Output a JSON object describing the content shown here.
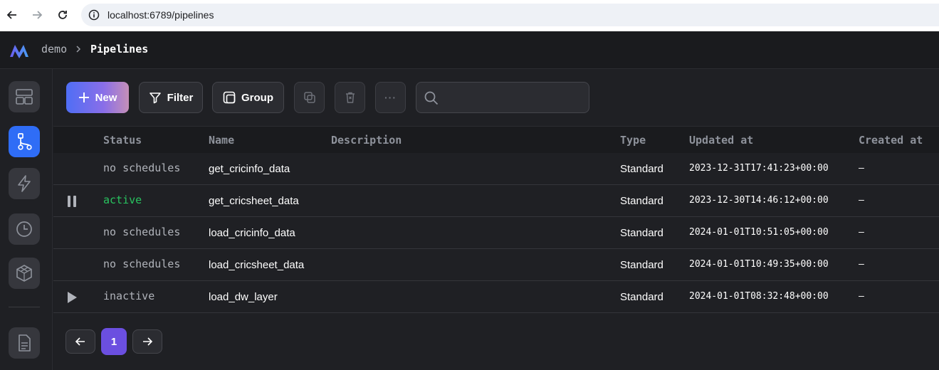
{
  "browser": {
    "url": "localhost:6789/pipelines"
  },
  "header": {
    "breadcrumb_root": "demo",
    "breadcrumb_current": "Pipelines"
  },
  "toolbar": {
    "new_label": "New",
    "filter_label": "Filter",
    "group_label": "Group",
    "more_label": "···",
    "search_value": ""
  },
  "table": {
    "columns": {
      "status": "Status",
      "name": "Name",
      "description": "Description",
      "type": "Type",
      "updated_at": "Updated at",
      "created_at": "Created at"
    },
    "rows": [
      {
        "status": "no schedules",
        "name": "get_cricinfo_data",
        "description": "",
        "type": "Standard",
        "updated_at": "2023-12-31T17:41:23+00:00",
        "created_at": "—",
        "action": ""
      },
      {
        "status": "active",
        "name": "get_cricsheet_data",
        "description": "",
        "type": "Standard",
        "updated_at": "2023-12-30T14:46:12+00:00",
        "created_at": "—",
        "action": "pause-icon"
      },
      {
        "status": "no schedules",
        "name": "load_cricinfo_data",
        "description": "",
        "type": "Standard",
        "updated_at": "2024-01-01T10:51:05+00:00",
        "created_at": "—",
        "action": ""
      },
      {
        "status": "no schedules",
        "name": "load_cricsheet_data",
        "description": "",
        "type": "Standard",
        "updated_at": "2024-01-01T10:49:35+00:00",
        "created_at": "—",
        "action": ""
      },
      {
        "status": "inactive",
        "name": "load_dw_layer",
        "description": "",
        "type": "Standard",
        "updated_at": "2024-01-01T08:32:48+00:00",
        "created_at": "—",
        "action": "play-icon"
      }
    ]
  },
  "pagination": {
    "current_page": "1"
  },
  "colors": {
    "accent": "#2f6df6",
    "active_status": "#28c35f",
    "page_active": "#6b4fe0"
  }
}
